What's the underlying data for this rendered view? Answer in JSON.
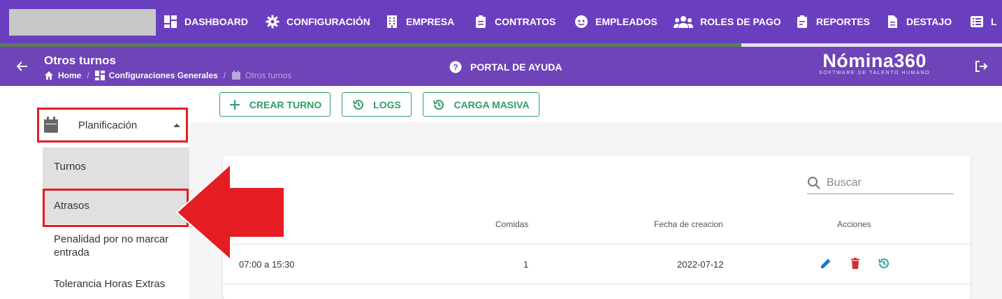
{
  "topnav": {
    "items": [
      {
        "label": "DASHBOARD",
        "icon": "dashboard-icon"
      },
      {
        "label": "CONFIGURACIÓN",
        "icon": "gear-icon"
      },
      {
        "label": "EMPRESA",
        "icon": "building-icon"
      },
      {
        "label": "CONTRATOS",
        "icon": "clipboard-icon"
      },
      {
        "label": "EMPLEADOS",
        "icon": "face-icon"
      },
      {
        "label": "ROLES DE PAGO",
        "icon": "people-icon"
      },
      {
        "label": "REPORTES",
        "icon": "report-icon"
      },
      {
        "label": "DESTAJO",
        "icon": "document-icon"
      },
      {
        "label": "L",
        "icon": "list-icon"
      }
    ],
    "progress": 0.74
  },
  "header": {
    "title": "Otros turnos",
    "breadcrumb": [
      "Home",
      "Configuraciones Generales",
      "Otros turnos"
    ],
    "help_label": "PORTAL DE AYUDA",
    "brand_name": "Nómina360",
    "brand_tagline": "SOFTWARE DE TALENTO HUMANO"
  },
  "sidebar": {
    "group_label": "Planificación",
    "items": [
      "Turnos",
      "Atrasos",
      "Penalidad por no marcar entrada",
      "Tolerancia Horas Extras"
    ]
  },
  "toolbar": {
    "create_label": "CREAR TURNO",
    "logs_label": "LOGS",
    "bulk_label": "CARGA MASIVA"
  },
  "table": {
    "search_placeholder": "Buscar",
    "headers": {
      "comidas": "Comidas",
      "fecha": "Fecha de creacion",
      "acciones": "Acciones"
    },
    "rows": [
      {
        "turno": "07:00 a 15:30",
        "comidas": "1",
        "fecha": "2022-07-12"
      }
    ]
  },
  "colors": {
    "nav_bg": "#6a3fbf",
    "accent_green": "#2e9e67",
    "highlight_red": "#e41c24",
    "edit_blue": "#1976d2",
    "delete_red": "#d32f2f",
    "history_teal": "#26a69a"
  }
}
